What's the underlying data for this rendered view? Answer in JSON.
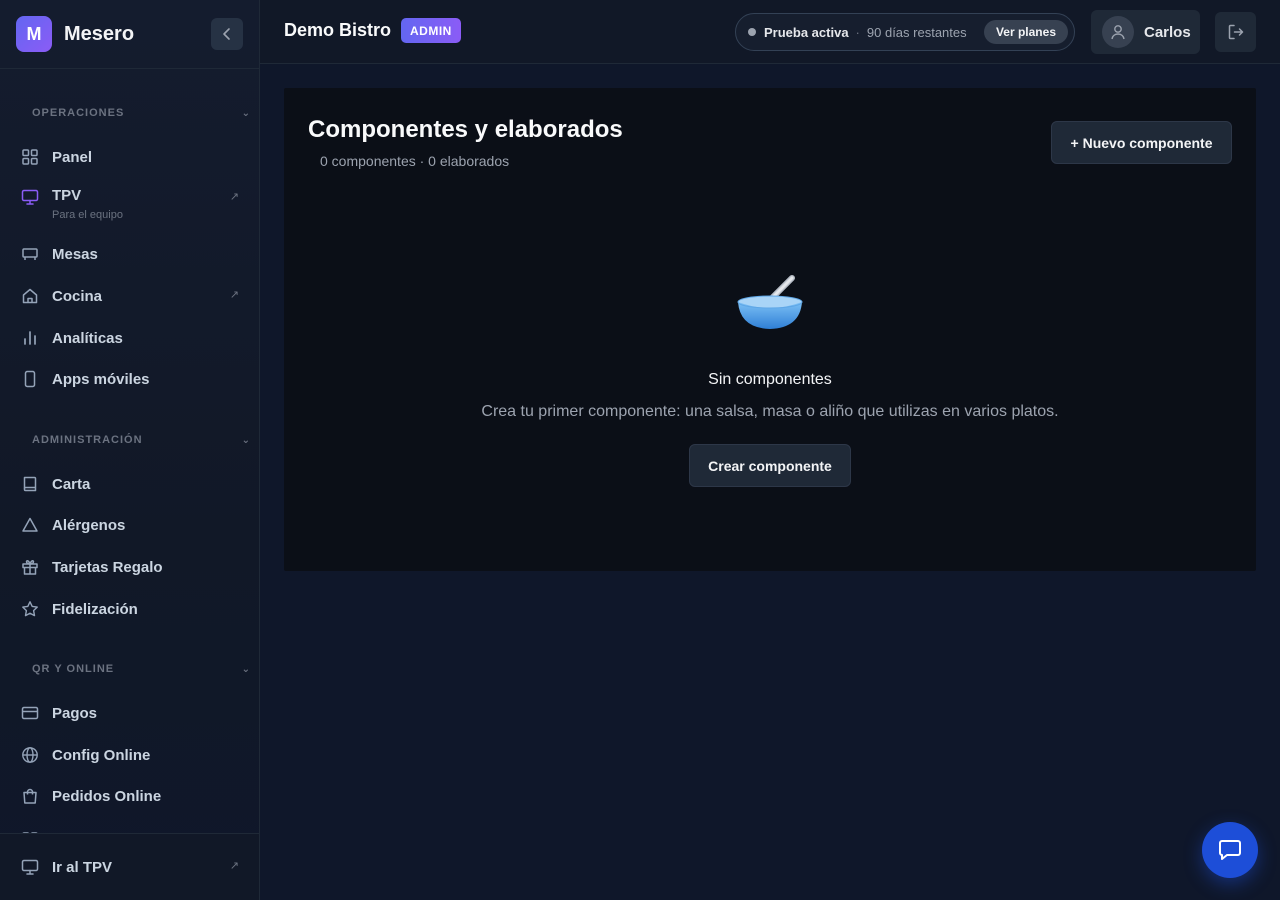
{
  "brand": {
    "initial": "M",
    "name": "Mesero"
  },
  "sidebar": {
    "sections": [
      {
        "title": "OPERACIONES"
      },
      {
        "title": "ADMINISTRACIÓN"
      },
      {
        "title": "QR Y ONLINE"
      }
    ],
    "items": [
      {
        "label": "Panel",
        "icon": "grid-icon"
      },
      {
        "label": "TPV",
        "sublabel": "Para el equipo",
        "icon": "monitor-icon",
        "external": true
      },
      {
        "label": "Mesas",
        "icon": "table-icon"
      },
      {
        "label": "Cocina",
        "icon": "home-icon",
        "external": true
      },
      {
        "label": "Analíticas",
        "icon": "bar-chart-icon"
      },
      {
        "label": "Apps móviles",
        "icon": "phone-icon"
      },
      {
        "label": "Carta",
        "icon": "book-icon"
      },
      {
        "label": "Alérgenos",
        "icon": "warning-icon"
      },
      {
        "label": "Tarjetas Regalo",
        "icon": "gift-icon"
      },
      {
        "label": "Fidelización",
        "icon": "star-icon"
      },
      {
        "label": "Pagos",
        "icon": "card-icon"
      },
      {
        "label": "Config Online",
        "icon": "globe-icon"
      },
      {
        "label": "Pedidos Online",
        "icon": "bag-icon"
      }
    ],
    "footer": {
      "label": "Ir al TPV",
      "icon": "monitor-icon"
    }
  },
  "topbar": {
    "restaurant": "Demo Bistro",
    "role": "ADMIN",
    "trial_label": "Prueba activa",
    "trial_separator": "·",
    "trial_days": "90 días restantes",
    "plans_button": "Ver planes",
    "user_name": "Carlos"
  },
  "main": {
    "title": "Componentes y elaborados",
    "subtitle": "0 componentes · 0 elaborados",
    "new_button": "+ Nuevo componente",
    "empty_title": "Sin componentes",
    "empty_text": "Crea tu primer componente: una salsa, masa o aliño que utilizas en varios platos.",
    "create_button": "Crear componente"
  },
  "colors": {
    "accent": "#6366f1",
    "accent_secondary": "#8b5cf6",
    "background": "#0f172a",
    "card": "#0b0f17",
    "chat_fab": "#1d4ed8"
  }
}
